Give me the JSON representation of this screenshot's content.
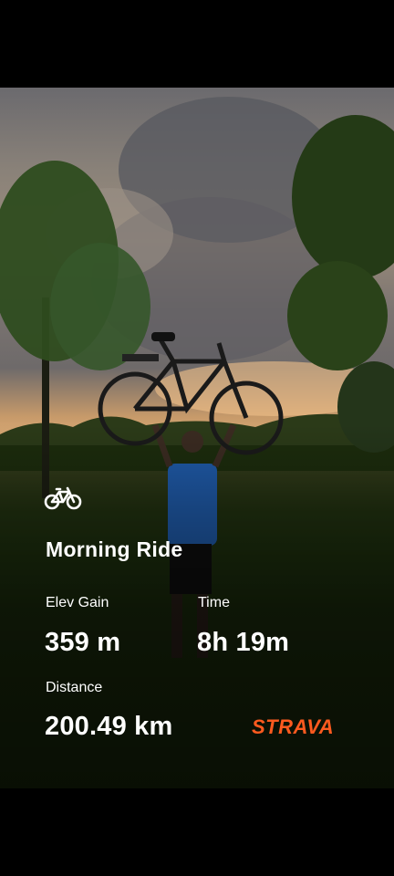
{
  "activity": {
    "icon": "bicycle-icon",
    "title": "Morning Ride"
  },
  "stats": {
    "elev_gain_label": "Elev Gain",
    "elev_gain_value": "359 m",
    "time_label": "Time",
    "time_value": "8h 19m",
    "distance_label": "Distance",
    "distance_value": "200.49 km"
  },
  "brand": {
    "name": "STRAVA",
    "color": "#fc5a1f"
  },
  "colors": {
    "text": "#ffffff",
    "background": "#000000"
  }
}
